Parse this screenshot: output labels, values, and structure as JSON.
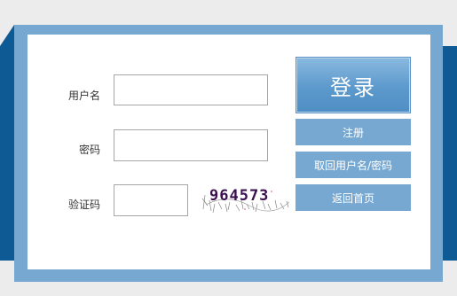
{
  "form": {
    "username_label": "用户名",
    "password_label": "密码",
    "captcha_label": "验证码",
    "username_value": "",
    "password_value": "",
    "captcha_value": ""
  },
  "captcha": {
    "text": "964573"
  },
  "buttons": {
    "login": "登录",
    "register": "注册",
    "recover": "取回用户名/密码",
    "home": "返回首页"
  },
  "colors": {
    "frame_dark": "#0e5a94",
    "frame_light": "#77a8d2",
    "panel": "#ffffff"
  }
}
